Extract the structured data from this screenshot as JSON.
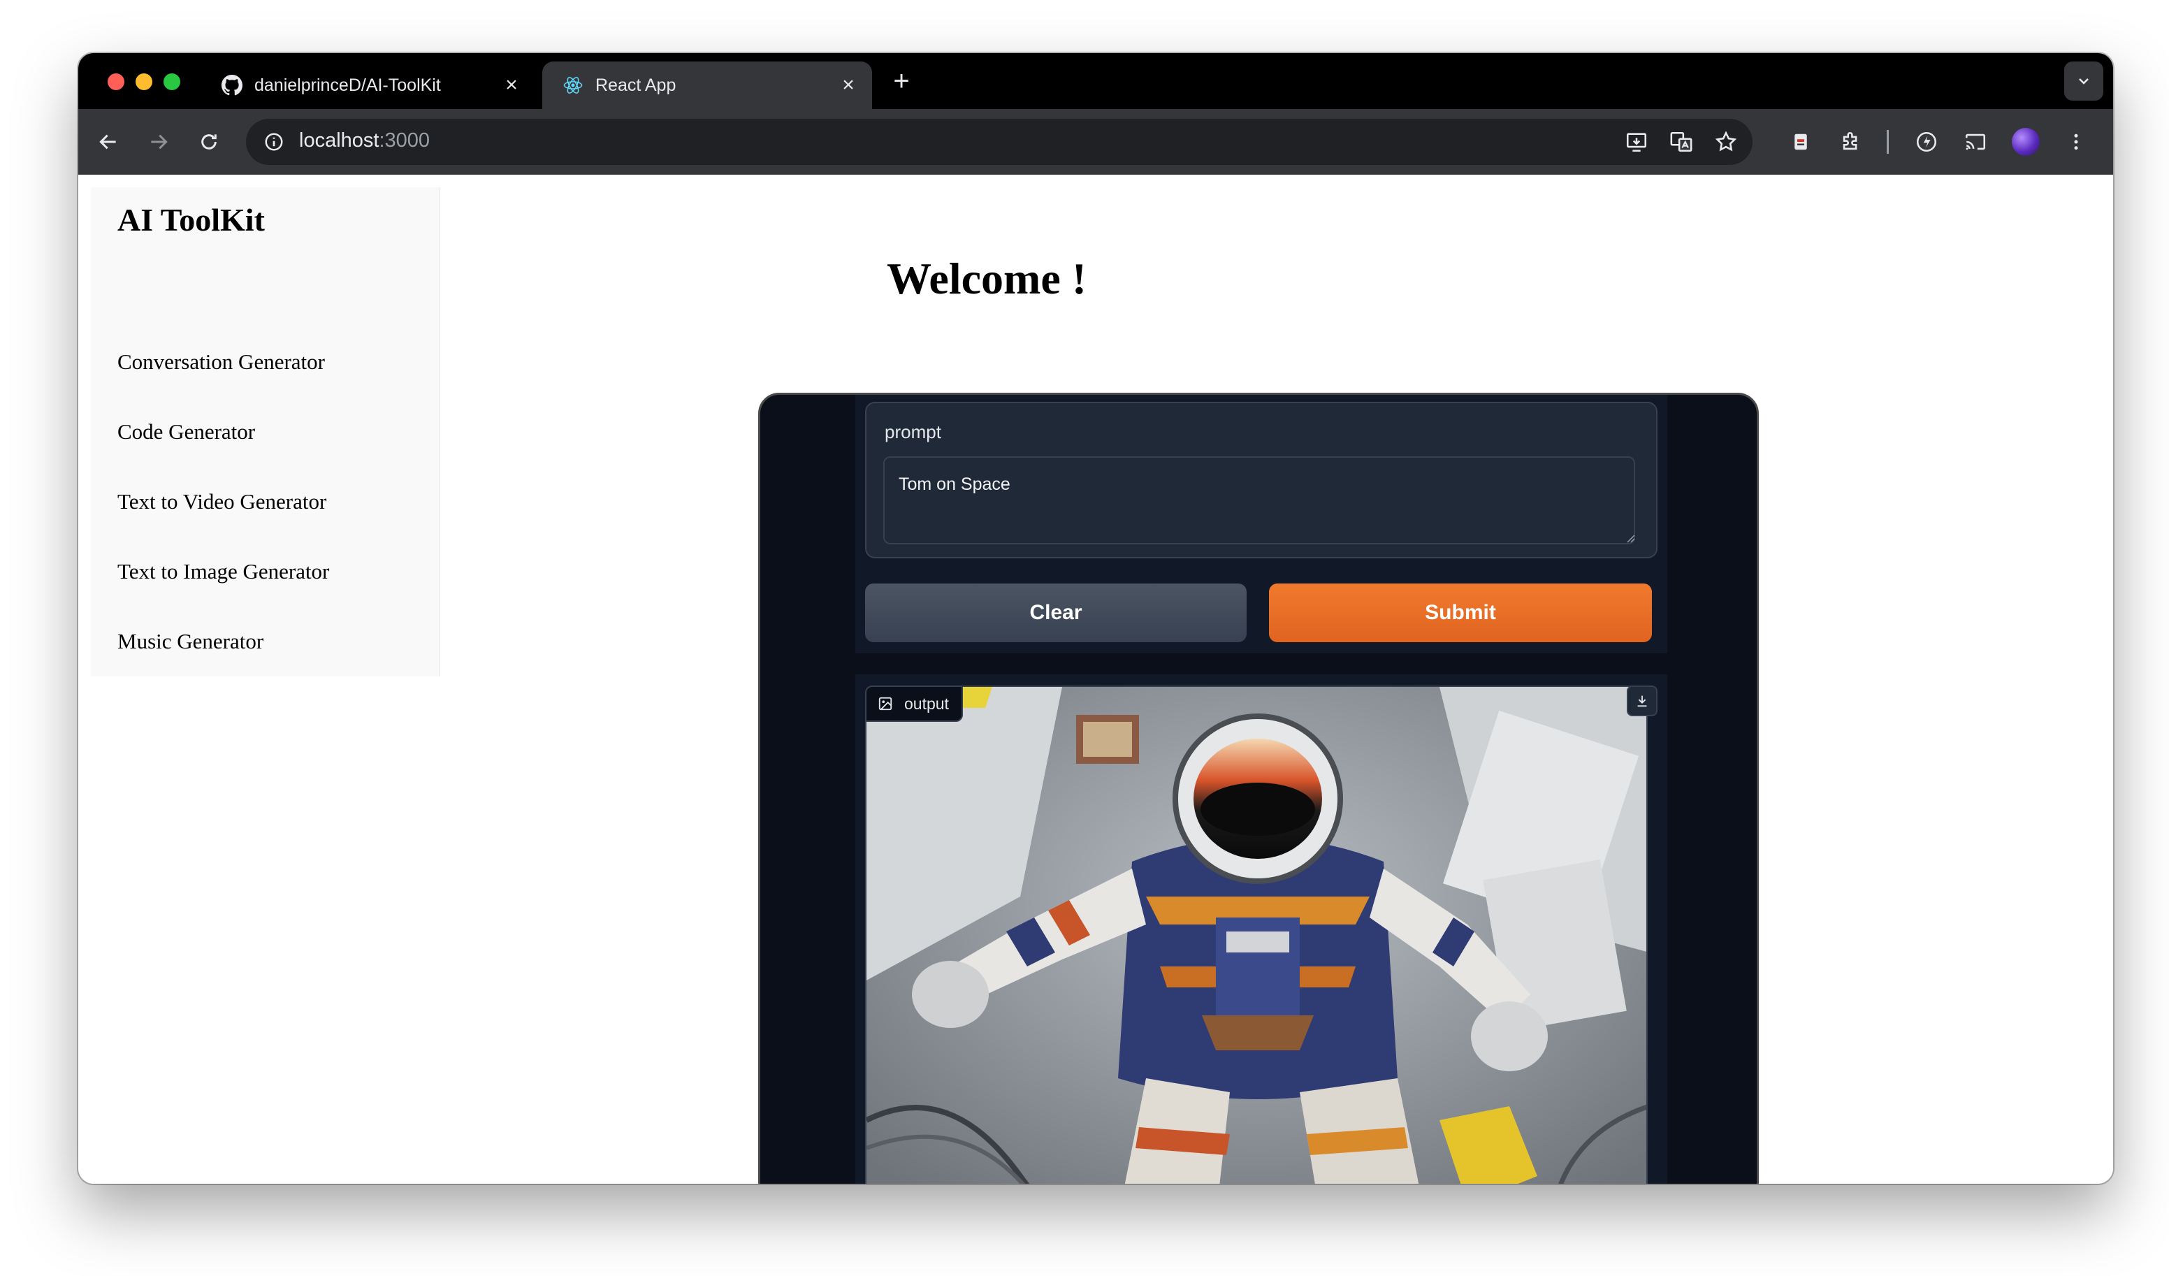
{
  "browser": {
    "tabs": [
      {
        "title": "danielprinceD/AI-ToolKit",
        "icon": "github-icon",
        "active": false
      },
      {
        "title": "React App",
        "icon": "react-icon",
        "active": true
      }
    ],
    "url": {
      "host": "localhost",
      "port": ":3000"
    }
  },
  "sidebar": {
    "brand": "AI ToolKit",
    "items": [
      {
        "label": "Conversation Generator"
      },
      {
        "label": "Code Generator"
      },
      {
        "label": "Text to Video Generator"
      },
      {
        "label": "Text to Image Generator"
      },
      {
        "label": "Music Generator"
      }
    ]
  },
  "main": {
    "heading": "Welcome !",
    "prompt": {
      "label": "prompt",
      "value": "Tom on Space"
    },
    "buttons": {
      "clear": "Clear",
      "submit": "Submit"
    },
    "output": {
      "label": "output"
    }
  },
  "colors": {
    "accent": "#e8702a",
    "app_bg": "#0b0f19",
    "panel_bg": "#1f2937"
  }
}
